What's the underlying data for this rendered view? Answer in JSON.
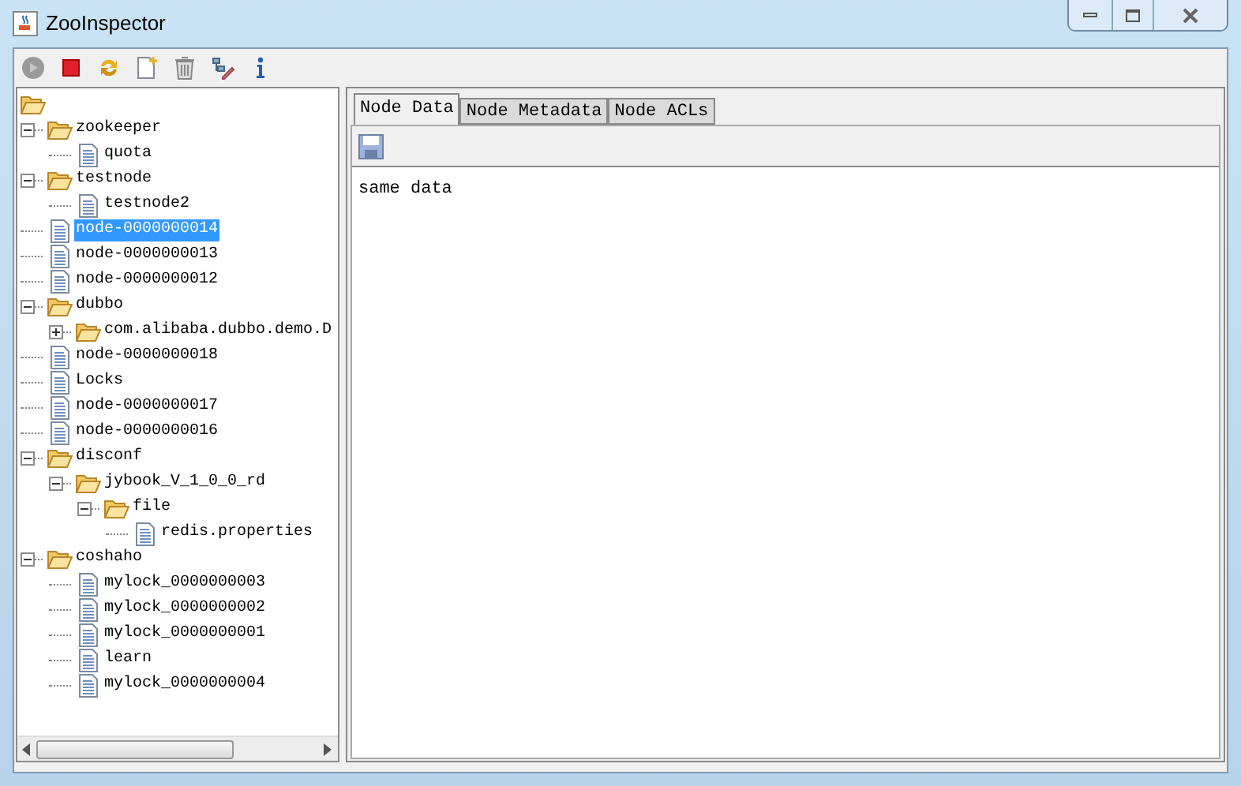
{
  "window": {
    "title": "ZooInspector"
  },
  "tree": {
    "children": [
      {
        "kind": "folder",
        "label": "zookeeper",
        "expanded": true,
        "selected": false,
        "children": [
          {
            "kind": "file",
            "label": "quota",
            "selected": false
          }
        ]
      },
      {
        "kind": "folder",
        "label": "testnode",
        "expanded": true,
        "selected": false,
        "children": [
          {
            "kind": "file",
            "label": "testnode2",
            "selected": false
          }
        ]
      },
      {
        "kind": "file",
        "label": "node-0000000014",
        "selected": true
      },
      {
        "kind": "file",
        "label": "node-0000000013",
        "selected": false
      },
      {
        "kind": "file",
        "label": "node-0000000012",
        "selected": false
      },
      {
        "kind": "folder",
        "label": "dubbo",
        "expanded": true,
        "selected": false,
        "children": [
          {
            "kind": "folder",
            "label": "com.alibaba.dubbo.demo.D",
            "expanded": false,
            "selected": false
          }
        ]
      },
      {
        "kind": "file",
        "label": "node-0000000018",
        "selected": false
      },
      {
        "kind": "file",
        "label": "Locks",
        "selected": false
      },
      {
        "kind": "file",
        "label": "node-0000000017",
        "selected": false
      },
      {
        "kind": "file",
        "label": "node-0000000016",
        "selected": false
      },
      {
        "kind": "folder",
        "label": "disconf",
        "expanded": true,
        "selected": false,
        "children": [
          {
            "kind": "folder",
            "label": "jybook_V_1_0_0_rd",
            "expanded": true,
            "selected": false,
            "children": [
              {
                "kind": "folder",
                "label": "file",
                "expanded": true,
                "selected": false,
                "children": [
                  {
                    "kind": "file",
                    "label": "redis.properties",
                    "selected": false
                  }
                ]
              }
            ]
          }
        ]
      },
      {
        "kind": "folder",
        "label": "coshaho",
        "expanded": true,
        "selected": false,
        "children": [
          {
            "kind": "file",
            "label": "mylock_0000000003",
            "selected": false
          },
          {
            "kind": "file",
            "label": "mylock_0000000002",
            "selected": false
          },
          {
            "kind": "file",
            "label": "mylock_0000000001",
            "selected": false
          },
          {
            "kind": "file",
            "label": "learn",
            "selected": false
          },
          {
            "kind": "file",
            "label": "mylock_0000000004",
            "selected": false
          }
        ]
      }
    ]
  },
  "tabs": [
    {
      "label": "Node Data",
      "selected": true
    },
    {
      "label": "Node Metadata",
      "selected": false
    },
    {
      "label": "Node ACLs",
      "selected": false
    }
  ],
  "node_data": {
    "value": "same data"
  }
}
